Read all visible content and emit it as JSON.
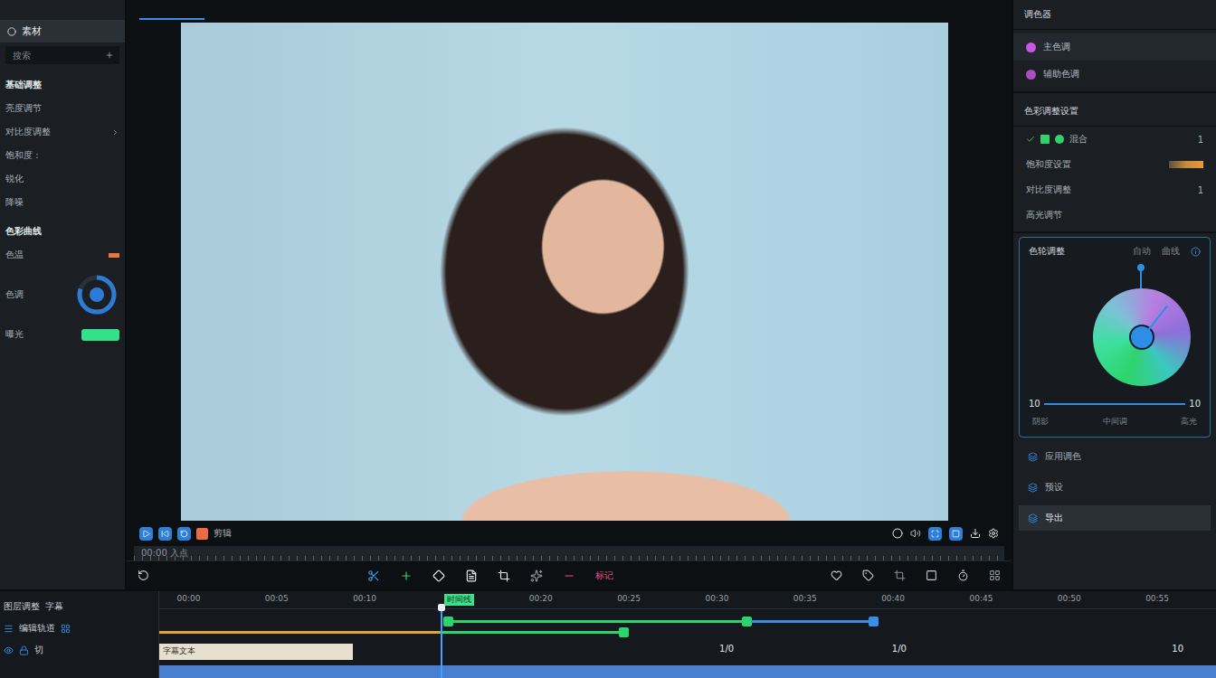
{
  "left_panel": {
    "tab": {
      "label": "素材",
      "selected": true
    },
    "search": {
      "placeholder": "搜索"
    },
    "sections": [
      {
        "title": "基础调整",
        "items": [
          {
            "label": "亮度调节",
            "kind": "plain"
          },
          {
            "label": "对比度调整",
            "kind": "plain"
          },
          {
            "label": "饱和度 :",
            "kind": "plain"
          },
          {
            "label": "锐化",
            "kind": "plain"
          },
          {
            "label": "降噪",
            "kind": "plain"
          }
        ]
      },
      {
        "title": "色彩曲线",
        "items": [
          {
            "label": "色温",
            "kind": "marker",
            "color": "#e8773a"
          },
          {
            "label": "色调",
            "kind": "ring",
            "level": 0.8
          },
          {
            "label": "曝光",
            "kind": "switch",
            "on": true
          }
        ]
      }
    ]
  },
  "transport": {
    "record_label": "剪辑"
  },
  "ruler": {
    "timecode": "00:00 入点"
  },
  "toolbar": {
    "mark_label": "标记"
  },
  "right_panel": {
    "title": "调色器",
    "layers": [
      {
        "label": "主色调",
        "selected": true,
        "color": "#c458e0"
      },
      {
        "label": "辅助色调",
        "selected": false,
        "color": "#a94dbf"
      }
    ],
    "settings_title": "色彩调整设置",
    "settings": [
      {
        "label": "混合",
        "kind": "swatches",
        "value": "1"
      },
      {
        "label": "饱和度设置",
        "kind": "gradient",
        "value": ""
      },
      {
        "label": "对比度调整",
        "kind": "plain",
        "value": "1"
      },
      {
        "label": "高光调节",
        "kind": "plain",
        "value": ""
      }
    ],
    "wheel_card": {
      "title": "色轮调整",
      "tabs": [
        {
          "label": "自动",
          "selected": false
        },
        {
          "label": "曲线",
          "selected": false
        }
      ],
      "slider": {
        "min": "10",
        "max": "10",
        "level": 1
      },
      "labels": [
        "阴影",
        "中间调",
        "高光"
      ]
    },
    "actions": [
      {
        "label": "应用调色",
        "selected": false
      },
      {
        "label": "预设",
        "selected": false
      },
      {
        "label": "导出",
        "selected": true
      }
    ]
  },
  "timeline": {
    "header": {
      "title": "图层调整",
      "sub": "字幕"
    },
    "track_headers": [
      {
        "label": "编辑轨道"
      },
      {
        "label": "切"
      }
    ],
    "scale_end": 60,
    "playhead": 16,
    "marker": {
      "label": "时间线",
      "at": 16
    },
    "ticks": [
      {
        "at": 1,
        "label": "00:00"
      },
      {
        "at": 6,
        "label": "00:05"
      },
      {
        "at": 11,
        "label": "00:10"
      },
      {
        "at": 21,
        "label": "00:20"
      },
      {
        "at": 26,
        "label": "00:25"
      },
      {
        "at": 31,
        "label": "00:30"
      },
      {
        "at": 36,
        "label": "00:35"
      },
      {
        "at": 41,
        "label": "00:40"
      },
      {
        "at": 46,
        "label": "00:45"
      },
      {
        "at": 51,
        "label": "00:50"
      },
      {
        "at": 56,
        "label": "00:55"
      }
    ],
    "track_a": [
      {
        "start": 16.4,
        "end": 33.4,
        "color": "#2fd36b",
        "start_key": true,
        "end_key": true
      },
      {
        "start": 33.6,
        "end": 40.6,
        "color": "#3a8ee6",
        "start_key": false,
        "end_key": true
      }
    ],
    "track_b": [
      {
        "start": 0,
        "end": 15.9,
        "color": "#e3a23a",
        "start_key": false,
        "end_key": false
      },
      {
        "start": 15.9,
        "end": 26.4,
        "color": "#2fd36b",
        "start_key": false,
        "end_key": true
      }
    ],
    "caption": {
      "label": "字幕文本",
      "start": 0,
      "end": 11
    },
    "marks": [
      {
        "at": 31.8,
        "label": "1/0"
      },
      {
        "at": 41.6,
        "label": "1/0"
      },
      {
        "at": 57.5,
        "label": "10"
      }
    ],
    "base_track": {
      "start": 0,
      "end": 60,
      "color": "#4a7fd0"
    }
  }
}
